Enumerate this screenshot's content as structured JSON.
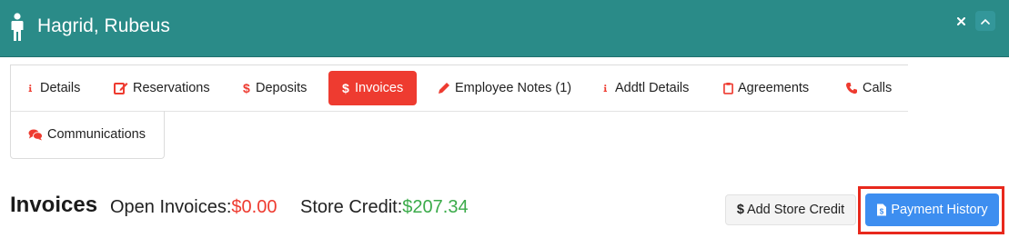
{
  "header": {
    "title": "Hagrid, Rubeus",
    "close_label": "×",
    "collapse_label": "⌃",
    "colors": {
      "background": "#2a8b88"
    }
  },
  "tabs": [
    {
      "label": "Details",
      "icon": "info-icon",
      "active": false
    },
    {
      "label": "Reservations",
      "icon": "edit-icon",
      "active": false
    },
    {
      "label": "Deposits",
      "icon": "dollar-icon",
      "active": false
    },
    {
      "label": "Invoices",
      "icon": "dollar-icon",
      "active": true
    },
    {
      "label": "Employee Notes (1)",
      "icon": "pencil-icon",
      "active": false
    },
    {
      "label": "Addtl Details",
      "icon": "info-icon",
      "active": false
    },
    {
      "label": "Agreements",
      "icon": "clipboard-icon",
      "active": false
    },
    {
      "label": "Calls",
      "icon": "phone-icon",
      "active": false
    },
    {
      "label": "Communications",
      "icon": "comments-icon",
      "active": false
    }
  ],
  "main": {
    "section_title": "Invoices",
    "open_invoices_label": "Open Invoices:",
    "open_invoices_value": "$0.00",
    "store_credit_label": "Store Credit:",
    "store_credit_value": "$207.34",
    "add_store_credit_label": "Add Store Credit",
    "payment_history_label": "Payment History"
  },
  "colors": {
    "accent_red": "#ee3b30",
    "credit_green": "#3bab4a",
    "primary_blue": "#3d8ef0",
    "highlight_red": "#e8281c"
  }
}
